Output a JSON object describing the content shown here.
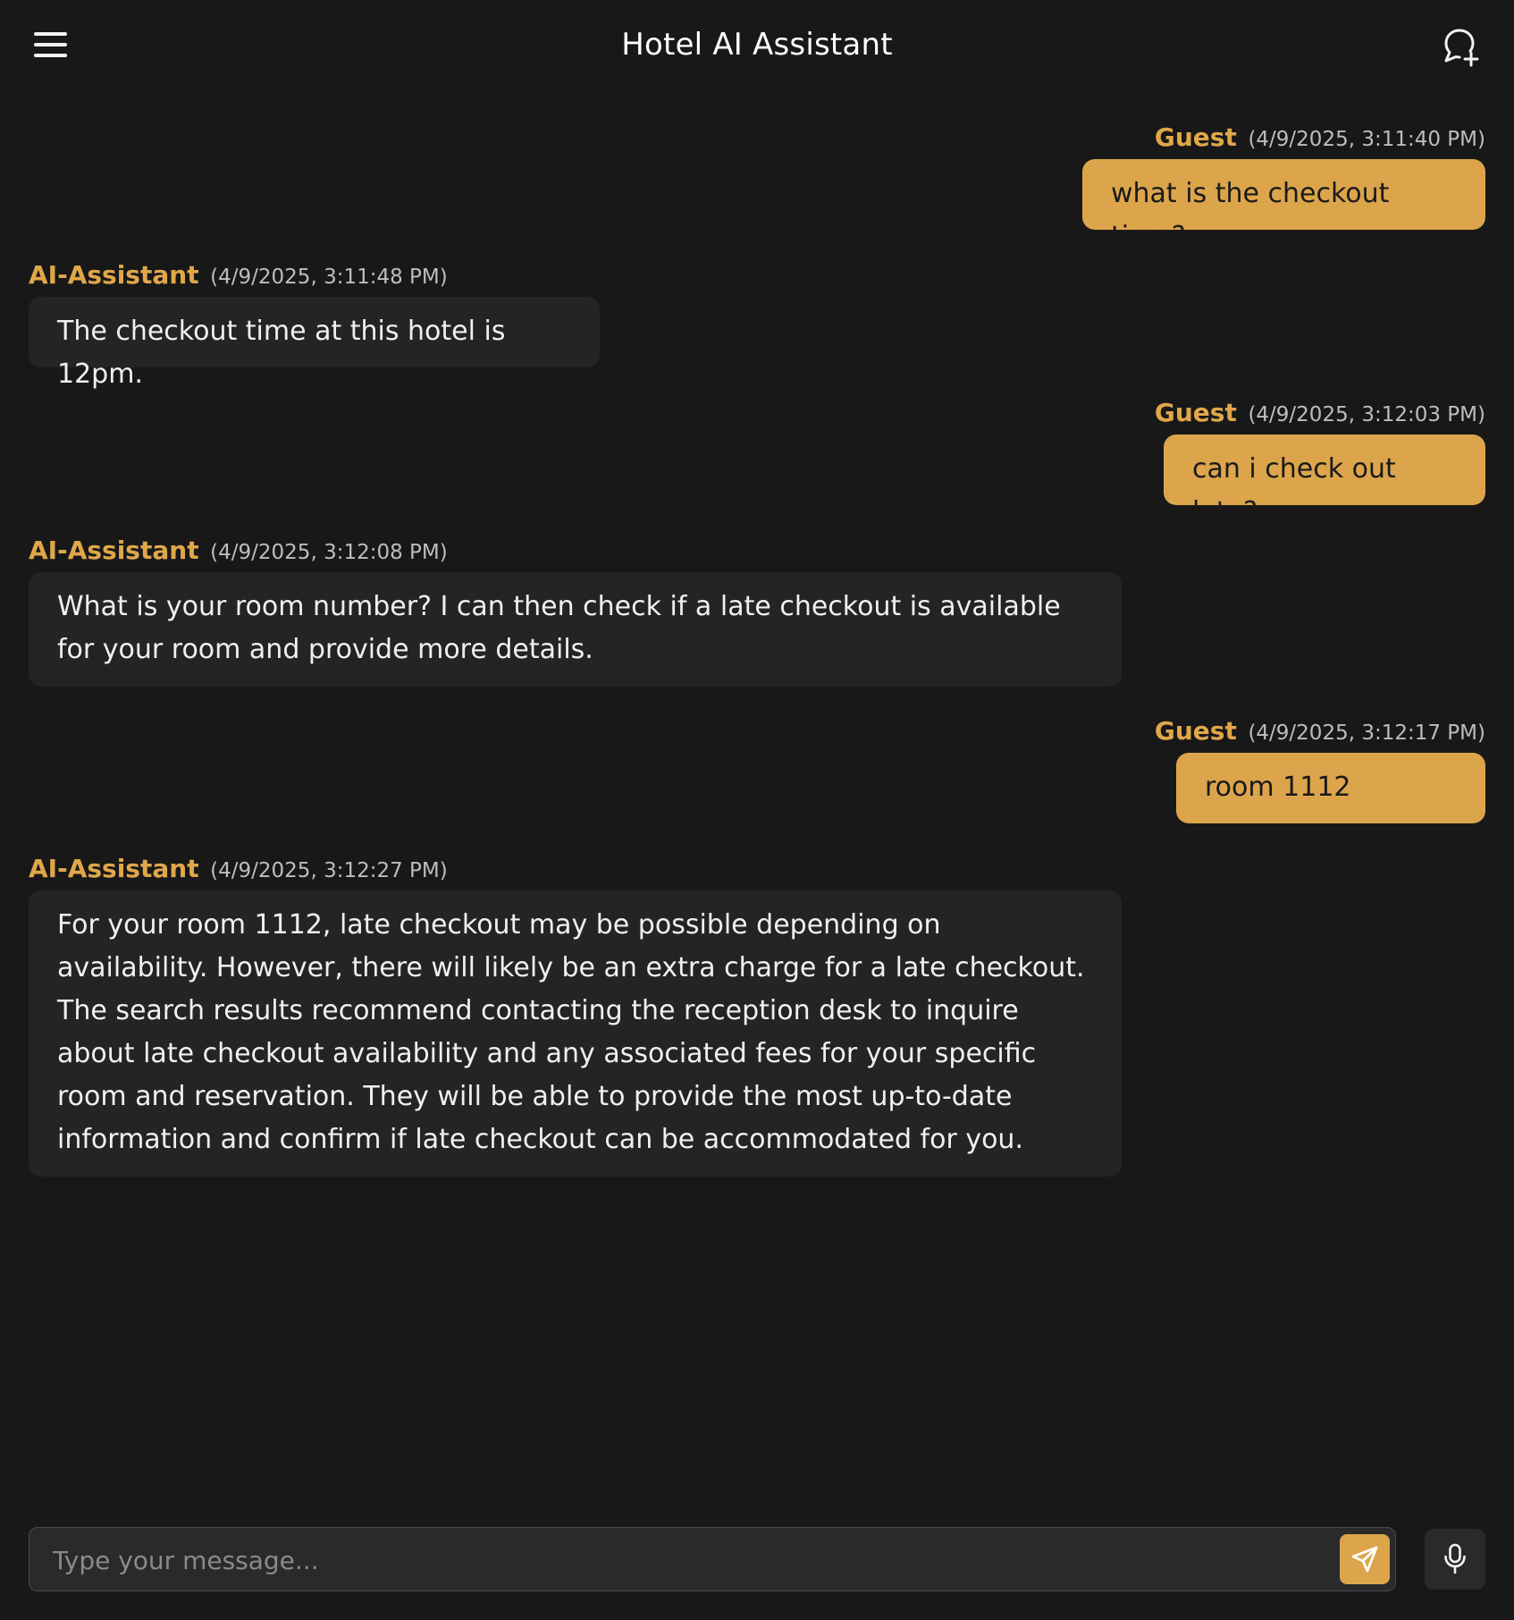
{
  "header": {
    "title": "Hotel AI Assistant",
    "menu_icon": "hamburger-menu-icon",
    "new_chat_icon": "new-chat-icon"
  },
  "colors": {
    "background": "#181818",
    "accent": "#dca54b",
    "ai_bubble": "#242424",
    "sender_label": "#e0a74a"
  },
  "messages": [
    {
      "sender": "Guest",
      "timestamp": "(4/9/2025, 3:11:40 PM)",
      "text": "what is the checkout time?"
    },
    {
      "sender": "AI-Assistant",
      "timestamp": "(4/9/2025, 3:11:48 PM)",
      "text": "The checkout time at this hotel is 12pm."
    },
    {
      "sender": "Guest",
      "timestamp": "(4/9/2025, 3:12:03 PM)",
      "text": "can i check out late?"
    },
    {
      "sender": "AI-Assistant",
      "timestamp": "(4/9/2025, 3:12:08 PM)",
      "text": "What is your room number? I can then check if a late checkout is available for your room and provide more details."
    },
    {
      "sender": "Guest",
      "timestamp": "(4/9/2025, 3:12:17 PM)",
      "text": "room 1112"
    },
    {
      "sender": "AI-Assistant",
      "timestamp": "(4/9/2025, 3:12:27 PM)",
      "text": "For your room 1112, late checkout may be possible depending on availability. However, there will likely be an extra charge for a late checkout. The search results recommend contacting the reception desk to inquire about late checkout availability and any associated fees for your specific room and reservation. They will be able to provide the most up-to-date information and confirm if late checkout can be accommodated for you."
    }
  ],
  "composer": {
    "placeholder": "Type your message...",
    "value": "",
    "send_icon": "send-icon",
    "mic_icon": "microphone-icon"
  }
}
